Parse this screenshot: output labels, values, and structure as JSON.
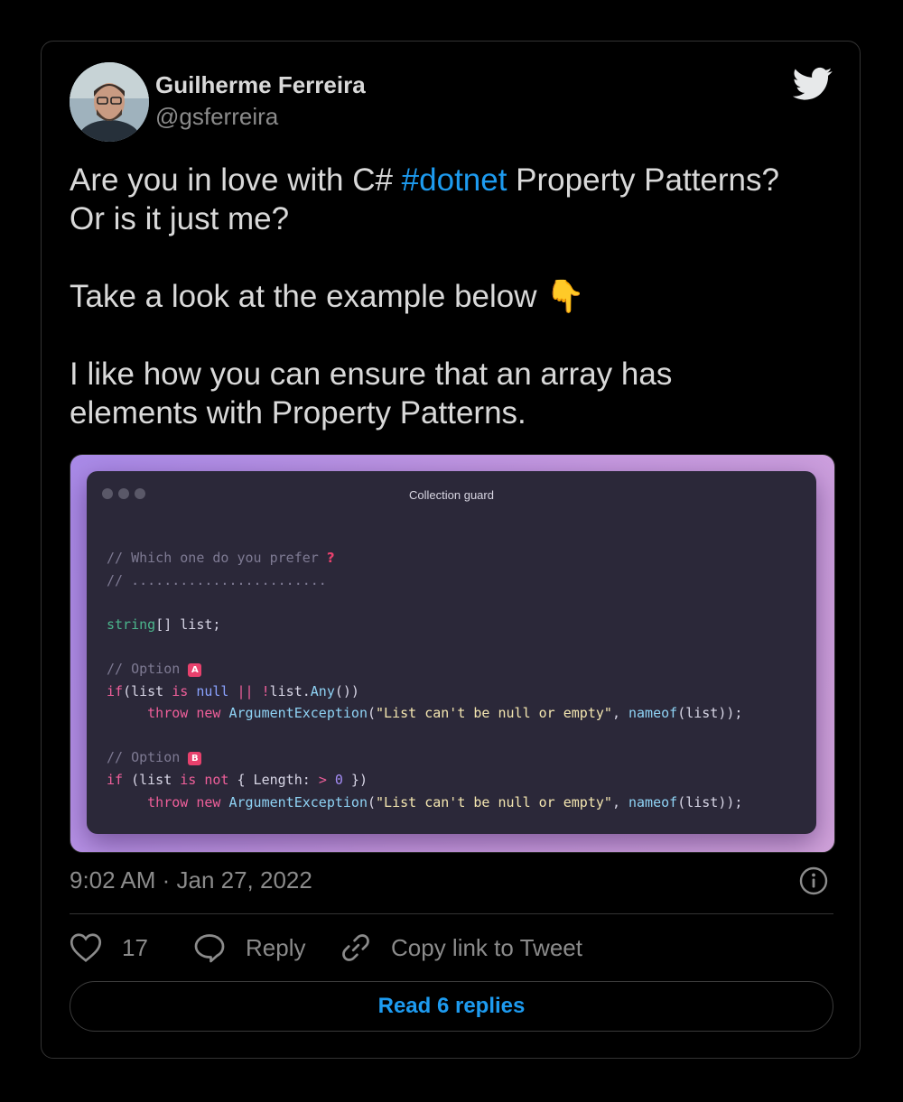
{
  "author": {
    "name": "Guilherme Ferreira",
    "handle": "@gsferreira"
  },
  "tweet": {
    "line1_pre": "Are you in love with C# ",
    "hashtag": "#dotnet",
    "line1_post": " Property Patterns?\nOr is it just me?\n\nTake a look at the example below ",
    "emoji": "👇",
    "line_last": "\n\nI like how you can ensure that an array has\nelements with Property Patterns."
  },
  "media": {
    "window_title": "Collection guard",
    "code": {
      "comment1": "// Which one do you prefer",
      "comment1_mark": "?",
      "comment2": "// ........................",
      "decl_type": "string",
      "decl_rest": "[] list;",
      "option_a_comment": "// Option ",
      "option_a_badge": "A",
      "if_a_kw": "if",
      "if_a_p1": "(list ",
      "if_a_is": "is",
      "if_a_null": " null ",
      "if_a_or": "||",
      "if_a_not": " !",
      "if_a_p2": "list.",
      "if_a_any": "Any",
      "if_a_p3": "())",
      "throw_kw": "throw",
      "new_kw": "new",
      "exc_type": "ArgumentException",
      "exc_msg": "\"List can't be null or empty\"",
      "nameof_fn": "nameof",
      "nameof_arg": "(list));",
      "option_b_comment": "// Option ",
      "option_b_badge": "B",
      "if_b_kw": "if",
      "if_b_p1": " (list ",
      "if_b_is": "is",
      "if_b_not": " not",
      "if_b_p2": " { Length: ",
      "if_b_gt": ">",
      "if_b_zero": "0",
      "if_b_p3": " })"
    }
  },
  "timestamp": "9:02 AM · Jan 27, 2022",
  "actions": {
    "like_count": "17",
    "reply_label": "Reply",
    "copy_label": "Copy link to Tweet"
  },
  "read_replies_label": "Read 6 replies",
  "colors": {
    "accent": "#1d9bf0",
    "background": "#000000",
    "text": "#d9d9d9",
    "muted": "#8b8b8b"
  }
}
